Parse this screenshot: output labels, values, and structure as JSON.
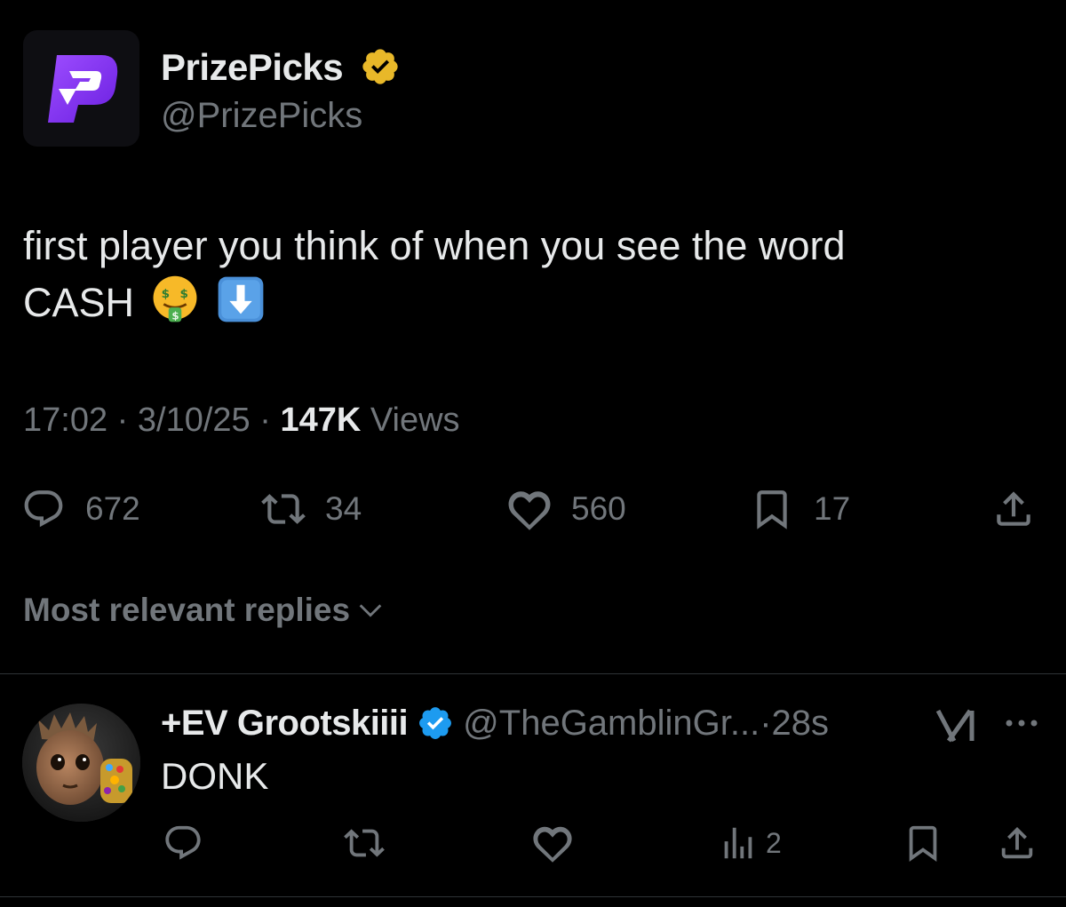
{
  "tweet": {
    "author": {
      "name": "PrizePicks",
      "handle": "@PrizePicks",
      "logo_letter": "P",
      "brand_color": "#7b2ff7",
      "verified_color": "#e8b829"
    },
    "text_line1": "first player you think of when you see the word",
    "text_line2": "CASH",
    "emojis": [
      "money-mouth-face",
      "down-arrow-button"
    ],
    "time": "17:02",
    "sep1": "·",
    "date": "3/10/25",
    "sep2": "·",
    "views_count": "147K",
    "views_label": "Views",
    "actions": {
      "replies": "672",
      "reposts": "34",
      "likes": "560",
      "bookmarks": "17"
    }
  },
  "replies_sort": {
    "label": "Most relevant replies",
    "icon": "chevron-down-icon"
  },
  "reply": {
    "name": "+EV Grootskiiii",
    "handle": "@TheGamblinGr...",
    "sep": "·",
    "time": "28s",
    "verified_color": "#1d9bf0",
    "text": "DONK",
    "views": "2"
  },
  "colors": {
    "background": "#000000",
    "text_primary": "#e7e9ea",
    "text_secondary": "#71767b",
    "divider": "#2f3336"
  }
}
